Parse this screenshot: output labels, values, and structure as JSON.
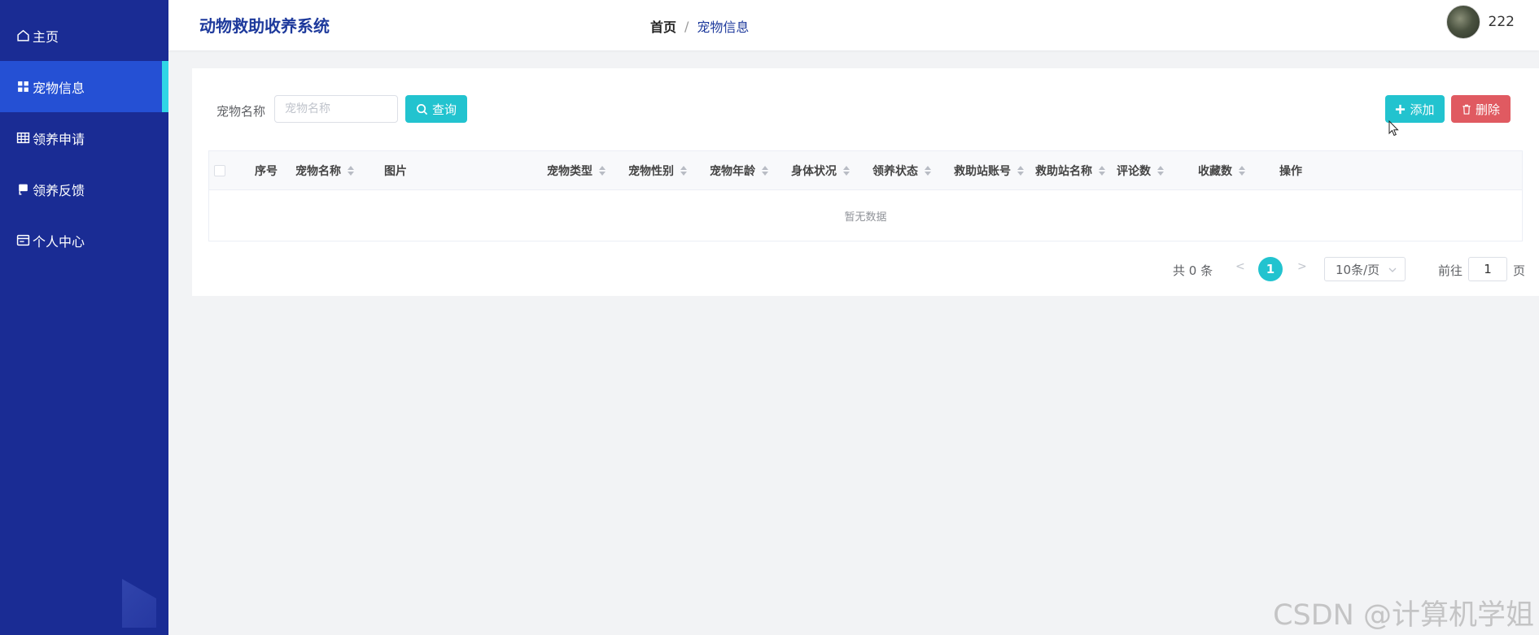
{
  "sidebar": {
    "items": [
      {
        "label": "主页",
        "icon": "home-icon",
        "active": false
      },
      {
        "label": "宠物信息",
        "icon": "grid-icon",
        "active": true
      },
      {
        "label": "领养申请",
        "icon": "table-icon",
        "active": false
      },
      {
        "label": "领养反馈",
        "icon": "chat-icon",
        "active": false
      },
      {
        "label": "个人中心",
        "icon": "profile-card-icon",
        "active": false
      }
    ]
  },
  "header": {
    "title": "动物救助收养系统",
    "breadcrumb": {
      "home": "首页",
      "separator": "/",
      "current": "宠物信息"
    },
    "user": {
      "name": "222"
    }
  },
  "search": {
    "label": "宠物名称",
    "placeholder": "宠物名称",
    "value": "",
    "button_label": "查询"
  },
  "actions": {
    "add_label": "添加",
    "delete_label": "删除"
  },
  "table": {
    "columns": [
      "序号",
      "宠物名称",
      "图片",
      "宠物类型",
      "宠物性别",
      "宠物年龄",
      "身体状况",
      "领养状态",
      "救助站账号",
      "救助站名称",
      "评论数",
      "收藏数",
      "操作"
    ],
    "rows": [],
    "empty_text": "暂无数据"
  },
  "pagination": {
    "total_text": "共 0 条",
    "current_page": "1",
    "page_size": "10条/页",
    "goto_label": "前往",
    "goto_value": "1",
    "page_unit": "页"
  },
  "watermark": "CSDN @计算机学姐",
  "colors": {
    "sidebar_bg": "#1a2c94",
    "sidebar_active": "#2550d4",
    "accent": "#22c3cf",
    "danger": "#e05a61",
    "title": "#1e3a9c"
  }
}
